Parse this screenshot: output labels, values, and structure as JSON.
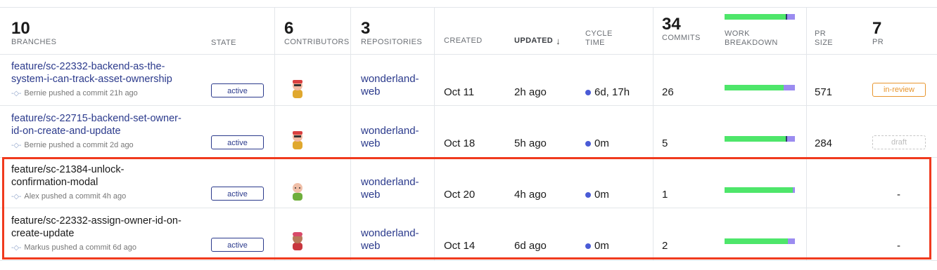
{
  "header": {
    "branches": {
      "count": "10",
      "label": "BRANCHES"
    },
    "state": {
      "label": "STATE"
    },
    "contributors": {
      "count": "6",
      "label": "CONTRIBUTORS"
    },
    "repositories": {
      "count": "3",
      "label": "REPOSITORIES"
    },
    "created": {
      "label": "CREATED"
    },
    "updated": {
      "label": "UPDATED",
      "sort_icon": "arrow-down-icon"
    },
    "cycle_time": {
      "line1": "CYCLE",
      "line2": "TIME"
    },
    "commits": {
      "count": "34",
      "label": "COMMITS"
    },
    "work_breakdown": {
      "line1": "WORK",
      "line2": "BREAKDOWN",
      "new_work": 0.88
    },
    "pr_size": {
      "line1": "PR",
      "line2": "SIZE"
    },
    "pr": {
      "count": "7",
      "label": "PR"
    }
  },
  "colors": {
    "link": "#2b3a8c",
    "bar_green": "#4ee66a",
    "bar_purple": "#9b8cf0",
    "highlight": "#f03a1e",
    "review": "#e8962e"
  },
  "rows": [
    {
      "branch_line1": "feature/sc-22332-backend-as-the-",
      "branch_line2": "system-i-can-track-asset-ownership",
      "activity": "Bernie pushed a commit 21h ago",
      "state": "active",
      "avatar": "avatar-bernie-icon",
      "repo_line1": "wonderland-",
      "repo_line2": "web",
      "created": "Oct 11",
      "updated": "2h ago",
      "cycle": "6d, 17h",
      "commits": "26",
      "work_new": 0.84,
      "pr_size": "571",
      "pr": "in-review"
    },
    {
      "branch_line1": "feature/sc-22715-backend-set-owner-",
      "branch_line2": "id-on-create-and-update",
      "activity": "Bernie pushed a commit 2d ago",
      "state": "active",
      "avatar": "avatar-bernie-icon",
      "repo_line1": "wonderland-",
      "repo_line2": "web",
      "created": "Oct 18",
      "updated": "5h ago",
      "cycle": "0m",
      "commits": "5",
      "work_new": 0.88,
      "pr_size": "284",
      "pr": "draft"
    },
    {
      "branch_line1": "feature/sc-21384-unlock-",
      "branch_line2": "confirmation-modal",
      "activity": "Alex pushed a commit 4h ago",
      "state": "active",
      "avatar": "avatar-alex-icon",
      "repo_line1": "wonderland-",
      "repo_line2": "web",
      "created": "Oct 20",
      "updated": "4h ago",
      "cycle": "0m",
      "commits": "1",
      "work_new": 0.97,
      "pr_size": "",
      "pr": "-"
    },
    {
      "branch_line1": "feature/sc-22332-assign-owner-id-on-",
      "branch_line2": "create-update",
      "activity": "Markus pushed a commit 6d ago",
      "state": "active",
      "avatar": "avatar-markus-icon",
      "repo_line1": "wonderland-",
      "repo_line2": "web",
      "created": "Oct 14",
      "updated": "6d ago",
      "cycle": "0m",
      "commits": "2",
      "work_new": 0.9,
      "pr_size": "",
      "pr": "-"
    }
  ]
}
